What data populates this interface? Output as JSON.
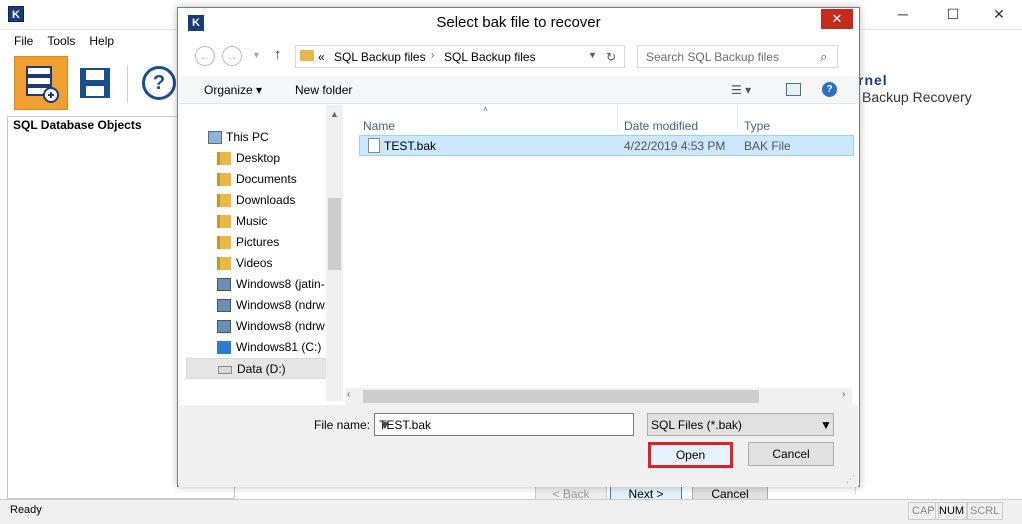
{
  "app": {
    "logo_letter": "K",
    "menu": [
      "File",
      "Tools",
      "Help"
    ],
    "left_panel_header": "SQL Database Objects",
    "brand_line1": "rnel",
    "brand_line2": "Backup Recovery",
    "status_text": "Ready",
    "indicators": [
      "CAP",
      "NUM",
      "SCRL"
    ],
    "wizard_back": "< Back",
    "wizard_next": "Next >",
    "wizard_cancel": "Cancel"
  },
  "dialog": {
    "title": "Select bak file to recover",
    "logo_letter": "K",
    "close_glyph": "✕",
    "address": {
      "prefix": "«",
      "crumb1": "SQL Backup files",
      "crumb2": "SQL Backup files"
    },
    "search_placeholder": "Search SQL Backup files",
    "organize": "Organize ▾",
    "new_folder": "New folder",
    "nav_items": [
      "This PC",
      "Desktop",
      "Documents",
      "Downloads",
      "Music",
      "Pictures",
      "Videos",
      "Windows8 (jatin-",
      "Windows8 (ndrw",
      "Windows8 (ndrw",
      "Windows81 (C:)",
      "Data (D:)"
    ],
    "columns": {
      "name": "Name",
      "date": "Date modified",
      "type": "Type"
    },
    "files": [
      {
        "name": "TEST.bak",
        "date": "4/22/2019 4:53 PM",
        "type": "BAK File"
      }
    ],
    "file_name_label": "File name:",
    "file_name_value": "TEST.bak",
    "filter_value": "SQL Files (*.bak)",
    "open_label": "Open",
    "cancel_label": "Cancel"
  },
  "colors": {
    "selection": "#cce8ff",
    "open_highlight": "#e31e24",
    "close_button": "#c42b1c",
    "toolbar_accent": "#f0a030"
  }
}
